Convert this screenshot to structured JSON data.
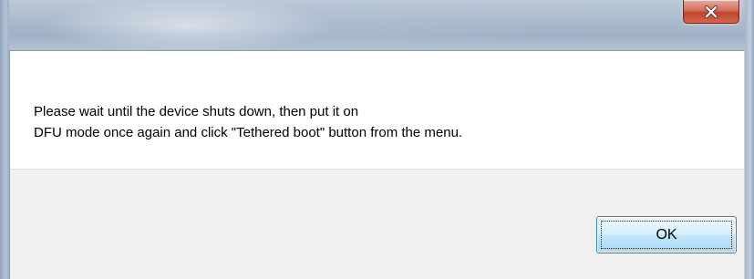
{
  "dialog": {
    "title": "",
    "message_line1": "Please wait until the device shuts down, then put it on",
    "message_line2": "DFU mode once again and click \"Tethered boot\" button from the menu.",
    "ok_label": "OK",
    "close_icon": "close-icon"
  },
  "colors": {
    "close_button": "#c0452c",
    "ok_button_border": "#3c7fb1",
    "button_area_bg": "#f0f0f0"
  }
}
